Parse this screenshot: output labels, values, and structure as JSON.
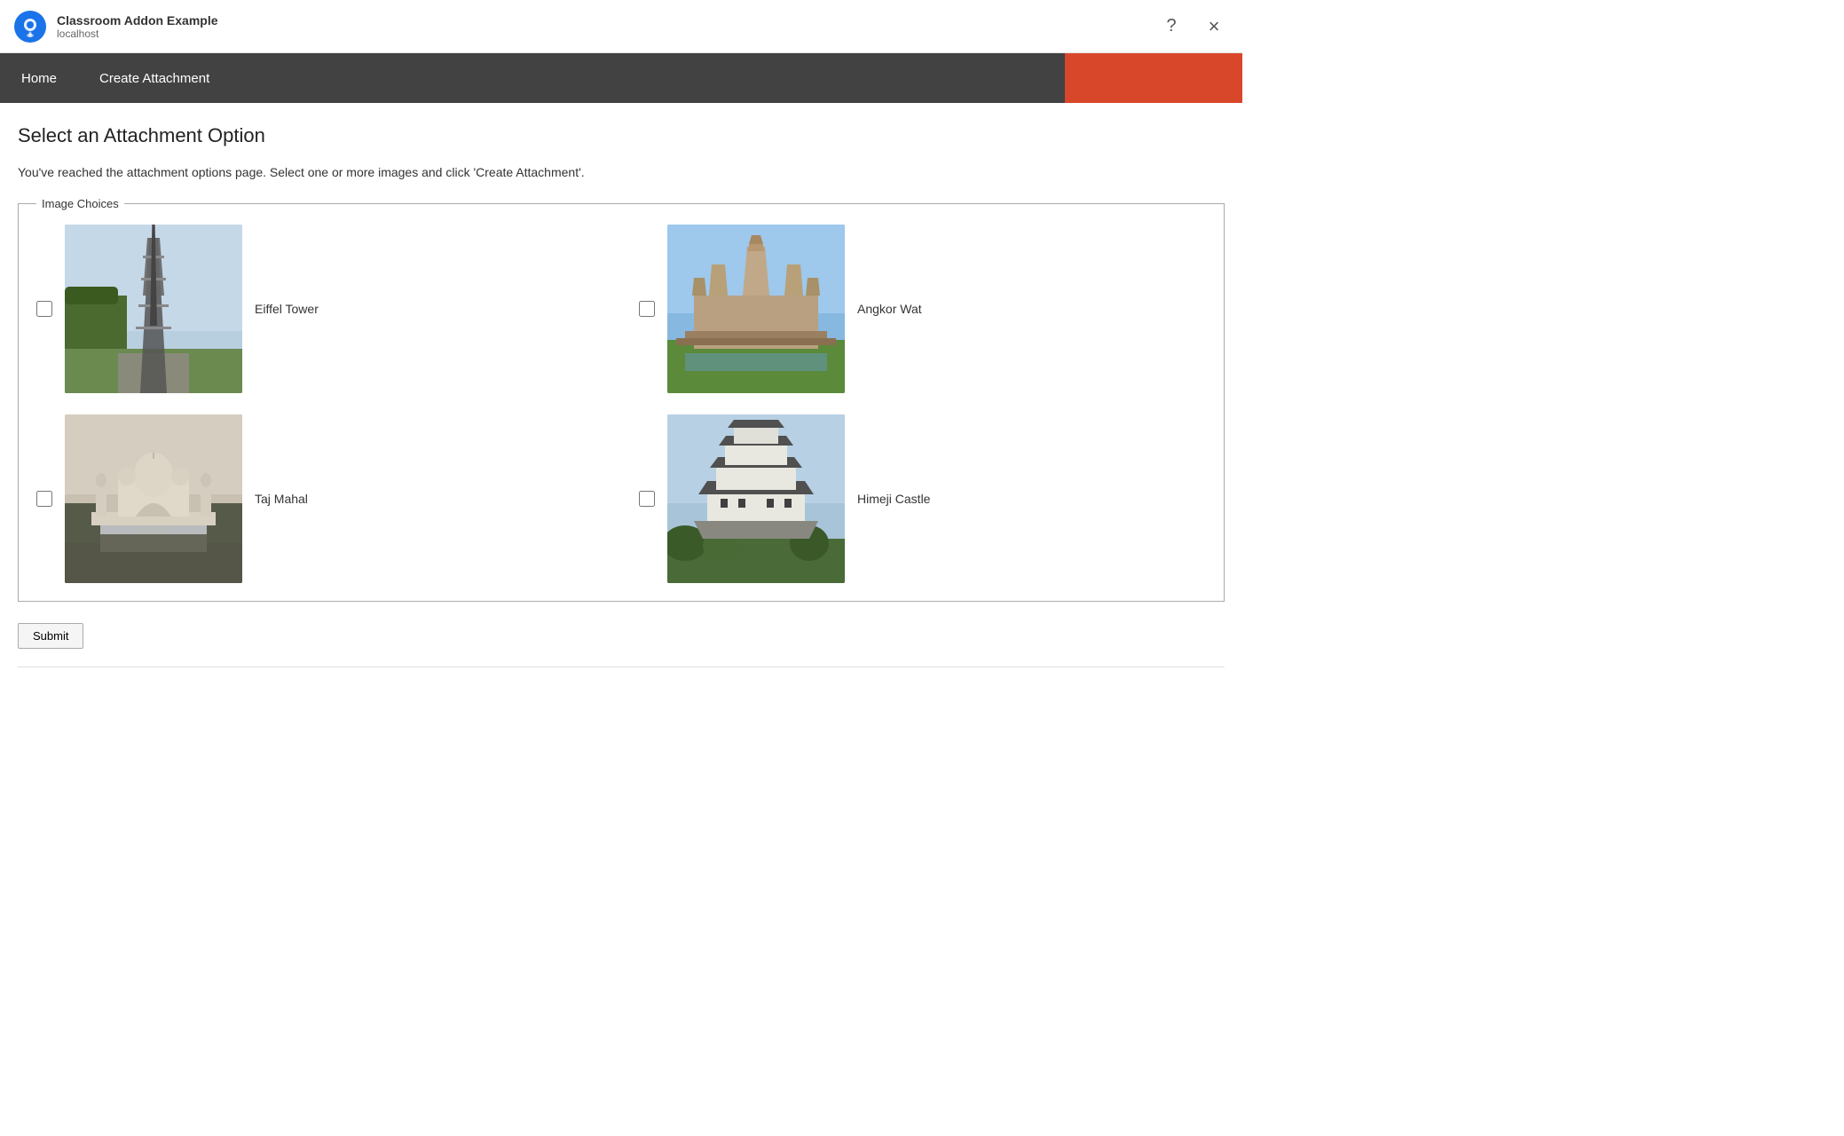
{
  "titlebar": {
    "app_name": "Classroom Addon Example",
    "app_url": "localhost",
    "help_icon": "?",
    "close_icon": "×"
  },
  "navbar": {
    "home_label": "Home",
    "create_label": "Create Attachment"
  },
  "main": {
    "heading": "Select an Attachment Option",
    "description": "You've reached the attachment options page. Select one or more images and click 'Create Attachment'.",
    "fieldset_legend": "Image Choices",
    "images": [
      {
        "id": "eiffel",
        "label": "Eiffel Tower",
        "checked": false
      },
      {
        "id": "angkor",
        "label": "Angkor Wat",
        "checked": false
      },
      {
        "id": "taj",
        "label": "Taj Mahal",
        "checked": false
      },
      {
        "id": "himeji",
        "label": "Himeji Castle",
        "checked": false
      }
    ],
    "submit_label": "Submit"
  },
  "colors": {
    "navbar_bg": "#424242",
    "navbar_accent": "#d9472b",
    "nav_text": "#ffffff"
  }
}
